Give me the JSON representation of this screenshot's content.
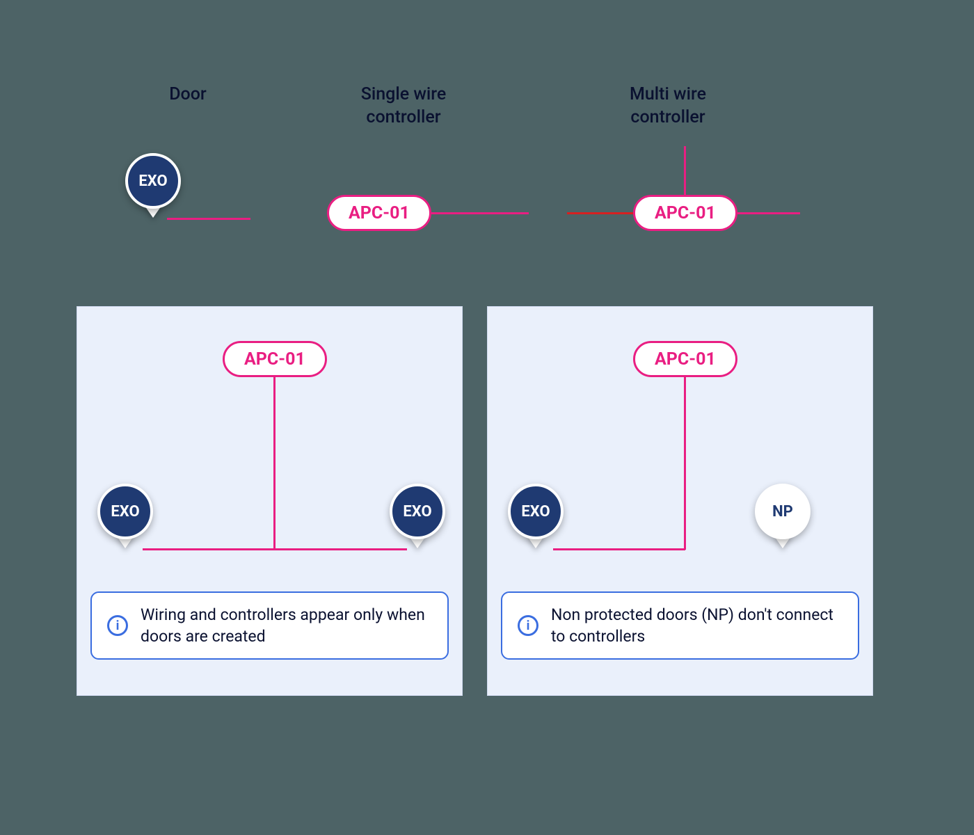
{
  "legend": {
    "door_label": "Door",
    "single_wire_label": "Single wire\ncontroller",
    "multi_wire_label": "Multi wire\ncontroller",
    "door_pin_text": "EXO",
    "controller_text": "APC-01"
  },
  "panel_left": {
    "controller_text": "APC-01",
    "door_a_text": "EXO",
    "door_b_text": "EXO",
    "info_text": "Wiring and controllers appear only when doors are created"
  },
  "panel_right": {
    "controller_text": "APC-01",
    "door_a_text": "EXO",
    "door_b_text": "NP",
    "info_text": "Non protected doors (NP) don't connect to controllers"
  },
  "colors": {
    "bg": "#4d6366",
    "panel_bg": "#eaf0fb",
    "pink": "#e91e82",
    "red": "#d62020",
    "navy": "#1f3a72",
    "info_border": "#3a6de0"
  }
}
